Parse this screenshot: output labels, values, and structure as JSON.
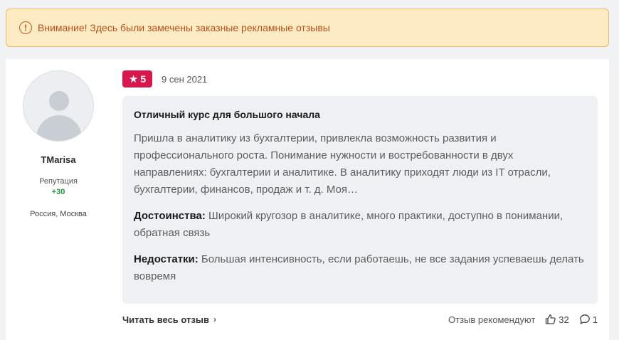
{
  "warning": {
    "icon": "exclamation-circle-icon",
    "text": "Внимание! Здесь были замечены заказные рекламные отзывы"
  },
  "author": {
    "name": "TMarisa",
    "reputation_label": "Репутация",
    "reputation_value": "+30",
    "location": "Россия, Москва"
  },
  "review": {
    "rating": "5",
    "date": "9 сен 2021",
    "title": "Отличный курс для большого начала",
    "text": "Пришла в аналитику из бухгалтерии, привлекла возможность развития и профессионального роста. Понимание нужности и востребованности в двух направлениях: бухгалтерии и аналитике. В аналитику приходят люди из IT отрасли, бухгалтерии, финансов, продаж и т. д. Моя…",
    "pros_label": "Достоинства:",
    "pros_text": " Широкий кругозор в аналитике, много практики, доступно в понимании, обратная связь",
    "cons_label": "Недостатки:",
    "cons_text": " Большая интенсивность, если работаешь, не все задания успеваешь делать вовремя"
  },
  "footer": {
    "read_more": "Читать весь отзыв",
    "recommend_label": "Отзыв рекомендуют",
    "likes": "32",
    "comments": "1"
  },
  "colors": {
    "warning_bg": "#fdebc4",
    "warning_text": "#b84f1a",
    "badge": "#d8174d",
    "reputation": "#1b9e3e"
  }
}
